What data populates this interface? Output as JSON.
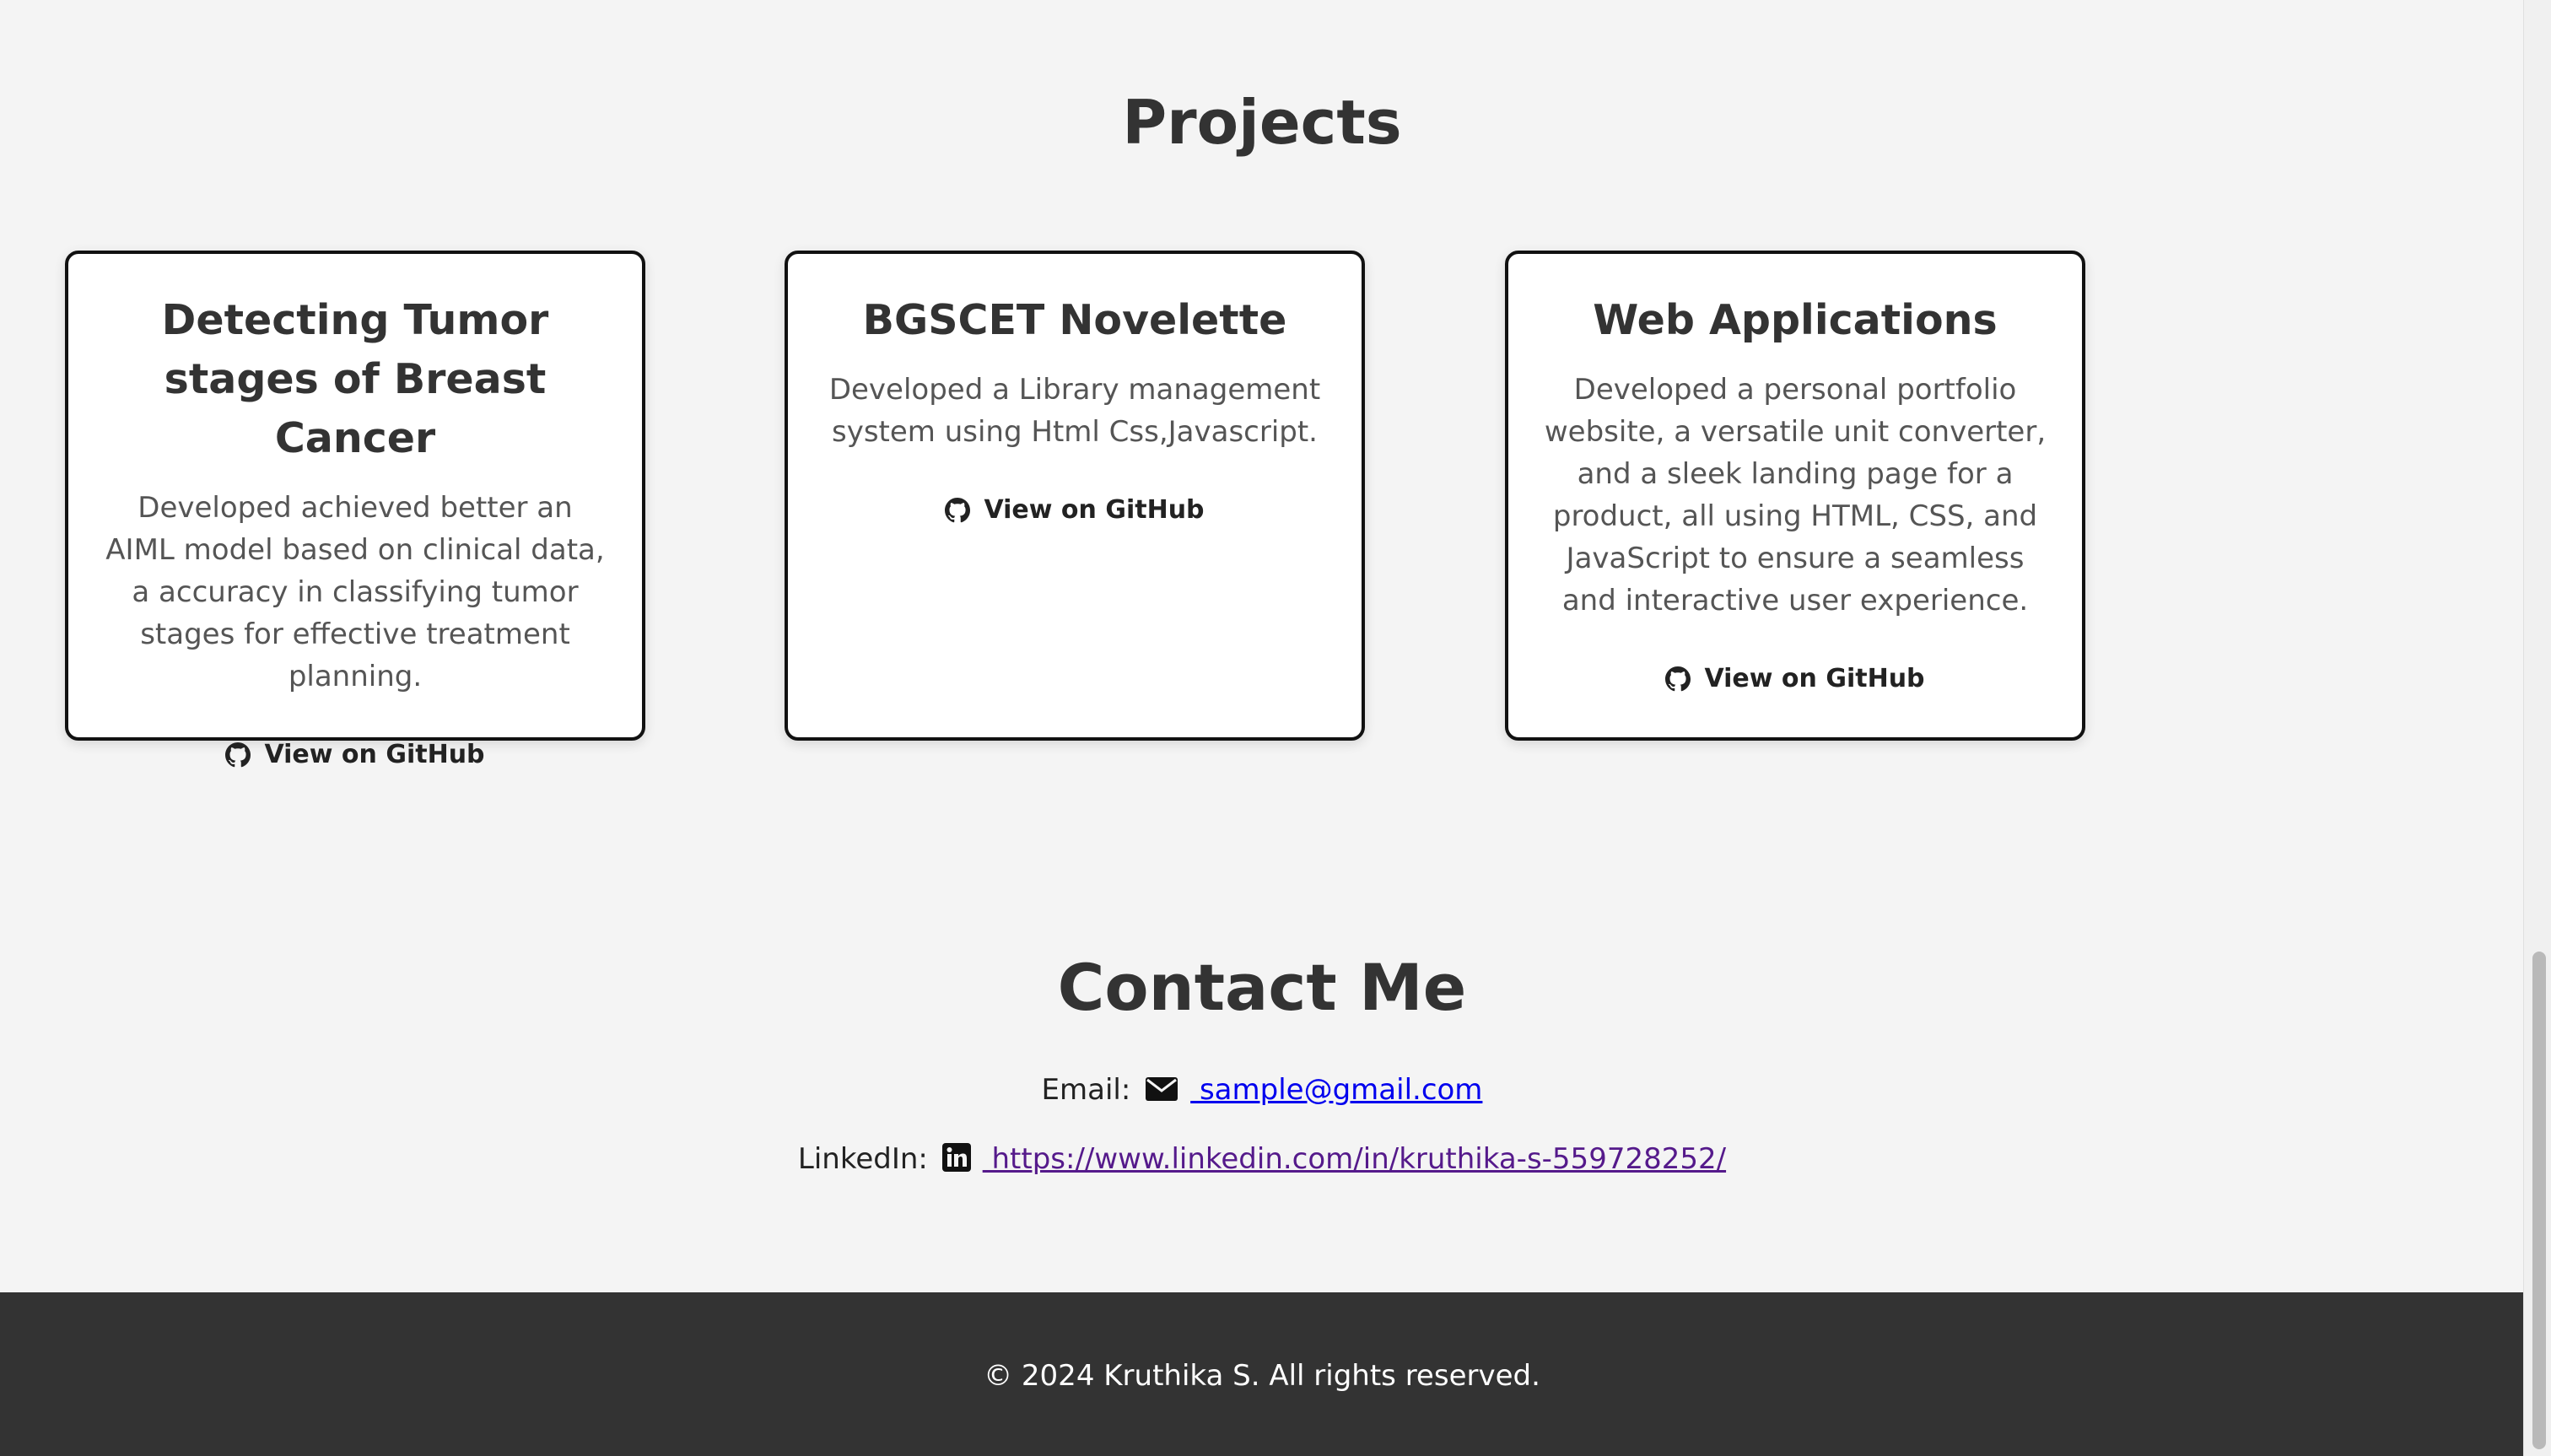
{
  "projects": {
    "title": "Projects",
    "items": [
      {
        "title": "Detecting Tumor stages of Breast Cancer",
        "description": "Developed achieved better an AIML model based on clinical data, a accuracy in classifying tumor stages for effective treatment planning.",
        "link_label": "View on GitHub",
        "icon": "github-icon"
      },
      {
        "title": "BGSCET Novelette",
        "description": "Developed a Library management system using Html Css,Javascript.",
        "link_label": "View on GitHub",
        "icon": "github-icon"
      },
      {
        "title": "Web Applications",
        "description": "Developed a personal portfolio website, a versatile unit converter, and a sleek landing page for a product, all using HTML, CSS, and JavaScript to ensure a seamless and interactive user experience.",
        "link_label": "View on GitHub",
        "icon": "github-icon"
      }
    ]
  },
  "contact": {
    "title": "Contact Me",
    "email_label": "Email:",
    "email_icon": "envelope-icon",
    "email_value": " sample@gmail.com",
    "linkedin_label": "LinkedIn:",
    "linkedin_icon": "linkedin-icon",
    "linkedin_value": " https://www.linkedin.com/in/kruthika-s-559728252/"
  },
  "footer": {
    "text": "© 2024 Kruthika S. All rights reserved."
  },
  "colors": {
    "background": "#f4f4f4",
    "footer_bg": "#333333",
    "link_blue": "#0000ee",
    "link_visited": "#551a8b"
  }
}
